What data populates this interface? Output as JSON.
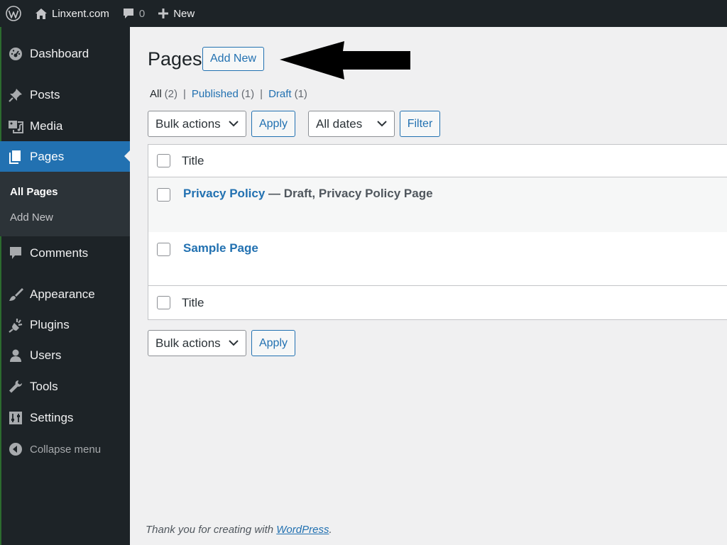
{
  "adminbar": {
    "site_name": "Linxent.com",
    "comments_count": "0",
    "new_label": "New"
  },
  "sidebar": {
    "items": [
      {
        "label": "Dashboard",
        "icon": "dashboard-icon"
      },
      {
        "label": "Posts",
        "icon": "pin-icon"
      },
      {
        "label": "Media",
        "icon": "media-icon"
      },
      {
        "label": "Pages",
        "icon": "pages-icon",
        "active": true
      },
      {
        "label": "Comments",
        "icon": "comment-icon"
      },
      {
        "label": "Appearance",
        "icon": "brush-icon"
      },
      {
        "label": "Plugins",
        "icon": "plug-icon"
      },
      {
        "label": "Users",
        "icon": "user-icon"
      },
      {
        "label": "Tools",
        "icon": "wrench-icon"
      },
      {
        "label": "Settings",
        "icon": "settings-icon"
      }
    ],
    "submenu": [
      {
        "label": "All Pages",
        "current": true
      },
      {
        "label": "Add New"
      }
    ],
    "collapse_label": "Collapse menu"
  },
  "main": {
    "title": "Pages",
    "add_new_label": "Add New",
    "filters": {
      "all_label": "All",
      "all_count": "(2)",
      "published_label": "Published",
      "published_count": "(1)",
      "draft_label": "Draft",
      "draft_count": "(1)",
      "separator": "|"
    },
    "bulk_actions": "Bulk actions",
    "apply_label": "Apply",
    "all_dates": "All dates",
    "filter_label": "Filter",
    "table": {
      "column_title": "Title",
      "rows": [
        {
          "title": "Privacy Policy",
          "state": " — Draft, Privacy Policy Page"
        },
        {
          "title": "Sample Page",
          "state": ""
        }
      ]
    },
    "footer": {
      "text": "Thank you for creating with ",
      "link": "WordPress",
      "end": "."
    }
  },
  "colors": {
    "admin_dark": "#1d2327",
    "accent_blue": "#2271b1",
    "background": "#f0f0f1"
  }
}
